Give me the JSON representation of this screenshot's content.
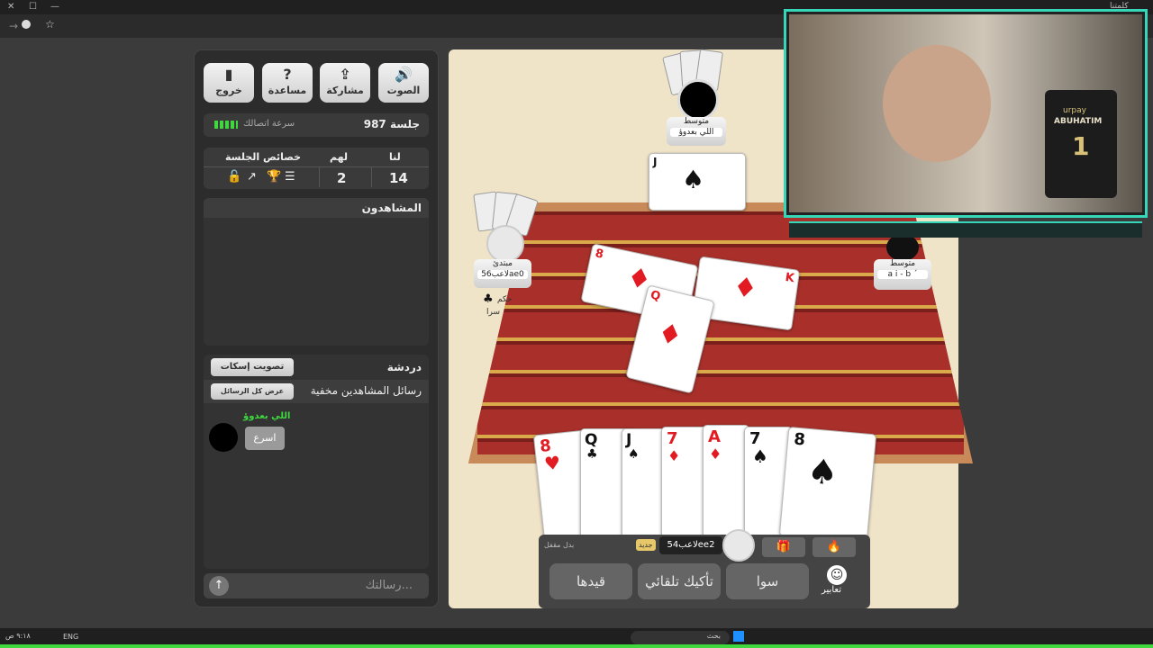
{
  "window": {
    "corner_label": "كلمتنا"
  },
  "topbar": {
    "buttons": [
      {
        "label": "خروج",
        "icon": "door-icon"
      },
      {
        "label": "مساعدة",
        "icon": "question-icon"
      },
      {
        "label": "مشاركة",
        "icon": "share-icon"
      },
      {
        "label": "الصوت",
        "icon": "speaker-icon"
      }
    ]
  },
  "session": {
    "title": "جلسة 987",
    "connection": "سرعة اتصالك"
  },
  "score": {
    "us_label": "لنا",
    "them_label": "لهم",
    "props_label": "خصائص الجلسة",
    "us": "14",
    "them": "2"
  },
  "spectators": {
    "title": "المشاهدون"
  },
  "chat": {
    "title": "دردشة",
    "mute_vote": "تصويت إسكات",
    "hidden_msg": "رسائل المشاهدين مخفية",
    "show_all": "عرض كل الرسائل",
    "username": "اللي بعدوؤ",
    "message": "اسرع",
    "input_placeholder": "رسالتك..."
  },
  "players": {
    "top": {
      "level": "متوسط",
      "name": "اللي بعدوؤ"
    },
    "left": {
      "level": "مبتدئ",
      "name": "لاعب56ae0",
      "tag1": "حكم",
      "tag2": "سرا"
    },
    "right": {
      "level": "متوسط",
      "name": "a i - b ´"
    },
    "me": {
      "name": "لاعب54ee2",
      "badge": "جديد",
      "status": "بدل مقفل"
    }
  },
  "hand": [
    {
      "rank": "8",
      "suit": "♥",
      "color": "red"
    },
    {
      "rank": "Q",
      "suit": "♣",
      "color": "blk"
    },
    {
      "rank": "J",
      "suit": "♠",
      "color": "blk"
    },
    {
      "rank": "7",
      "suit": "♦",
      "color": "red"
    },
    {
      "rank": "A",
      "suit": "♦",
      "color": "red"
    },
    {
      "rank": "7",
      "suit": "♠",
      "color": "blk"
    },
    {
      "rank": "8",
      "suit": "♠",
      "color": "blk"
    }
  ],
  "table_cards": [
    {
      "rank": "J",
      "suit": "♠"
    },
    {
      "rank": "8",
      "suit": "♦"
    },
    {
      "rank": "K",
      "suit": "♦"
    },
    {
      "rank": "Q",
      "suit": "♦"
    }
  ],
  "actions": {
    "qaydha": "قيدها",
    "auto": "تأكيك تلقائي",
    "sawa": "سوا",
    "emotes": "تعابير"
  },
  "overlay": {
    "shirt_brand": "urpay",
    "shirt_name": "ABUHATIM",
    "shirt_number": "1"
  },
  "taskbar": {
    "lang": "ENG",
    "time": "٩:١٨ ص",
    "search": "بحث"
  },
  "colors": {
    "accent": "#3fd83f",
    "panel": "#2c2c2c",
    "game_bg": "#efe3c8",
    "teal": "#36d6b8"
  }
}
